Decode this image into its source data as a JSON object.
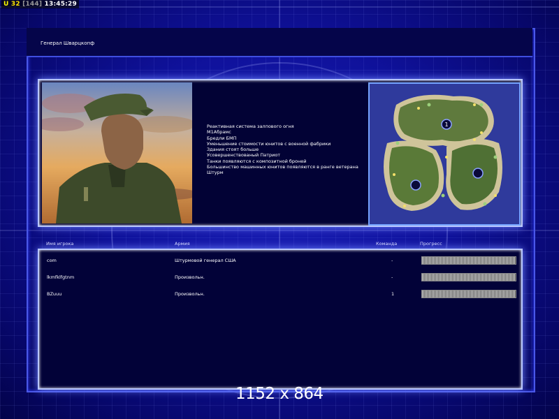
{
  "hud": {
    "counter": "32",
    "counter_total": "144",
    "clock": "13:45:29",
    "counter_prefix": "U"
  },
  "title": "Генерал Шварцкопф",
  "features": [
    "Реактивная система залпового огня",
    "М1Абрамс",
    "Бредли БМП",
    "Уменьшение стоимости юнитов с военной фабрики",
    "Здания стоят больше",
    "Усовершенствованый Патриот",
    "Танки появляются с композитной броней",
    "Большинство машинных юнитов появляются в ранге ветерана",
    "Штурм"
  ],
  "map": {
    "start_markers": [
      "1",
      "",
      ""
    ]
  },
  "table": {
    "headers": {
      "name": "Имя игрока",
      "army": "Армия",
      "team": "Команда",
      "progress": "Прогресс"
    },
    "rows": [
      {
        "name": "com",
        "army": "Штурмовой генерал США",
        "team": "-"
      },
      {
        "name": "lkmfklfgtnm",
        "army": "Произвольн.",
        "team": "-"
      },
      {
        "name": "BZuuu",
        "army": "Произвольн.",
        "team": "1"
      }
    ]
  },
  "resolution": "1152 x 864",
  "colors": {
    "frame": "#4a58e8",
    "panel_border": "#b8c6ff",
    "background": "#0f119a"
  }
}
